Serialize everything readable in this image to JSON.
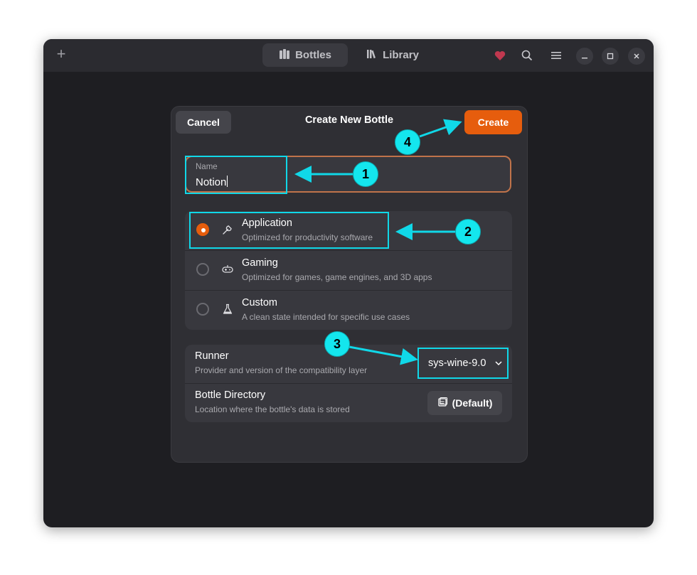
{
  "header": {
    "tabs": [
      {
        "label": "Bottles",
        "icon": "bottles-icon",
        "active": true
      },
      {
        "label": "Library",
        "icon": "library-icon",
        "active": false
      }
    ],
    "icons": [
      "add-icon",
      "heart-icon",
      "search-icon",
      "menu-icon"
    ],
    "window_controls": [
      "minimize",
      "maximize",
      "close"
    ]
  },
  "dialog": {
    "title": "Create New Bottle",
    "cancel_label": "Cancel",
    "create_label": "Create",
    "name": {
      "label": "Name",
      "value": "Notion"
    },
    "environments": [
      {
        "title": "Application",
        "subtitle": "Optimized for productivity software",
        "icon": "wrench-icon",
        "selected": true
      },
      {
        "title": "Gaming",
        "subtitle": "Optimized for games, game engines, and 3D apps",
        "icon": "gamepad-icon",
        "selected": false
      },
      {
        "title": "Custom",
        "subtitle": "A clean state intended for specific use cases",
        "icon": "flask-icon",
        "selected": false
      }
    ],
    "runner": {
      "title": "Runner",
      "subtitle": "Provider and version of the compatibility layer",
      "value": "sys-wine-9.0"
    },
    "directory": {
      "title": "Bottle Directory",
      "subtitle": "Location where the bottle's data is stored",
      "button_label": "(Default)"
    }
  },
  "annotations": [
    "1",
    "2",
    "3",
    "4"
  ],
  "colors": {
    "accent": "#e65d0d",
    "highlight": "#10d8e8",
    "heart": "#c0384f",
    "window_bg": "#1e1e22",
    "dialog_bg": "#2f2f34"
  }
}
